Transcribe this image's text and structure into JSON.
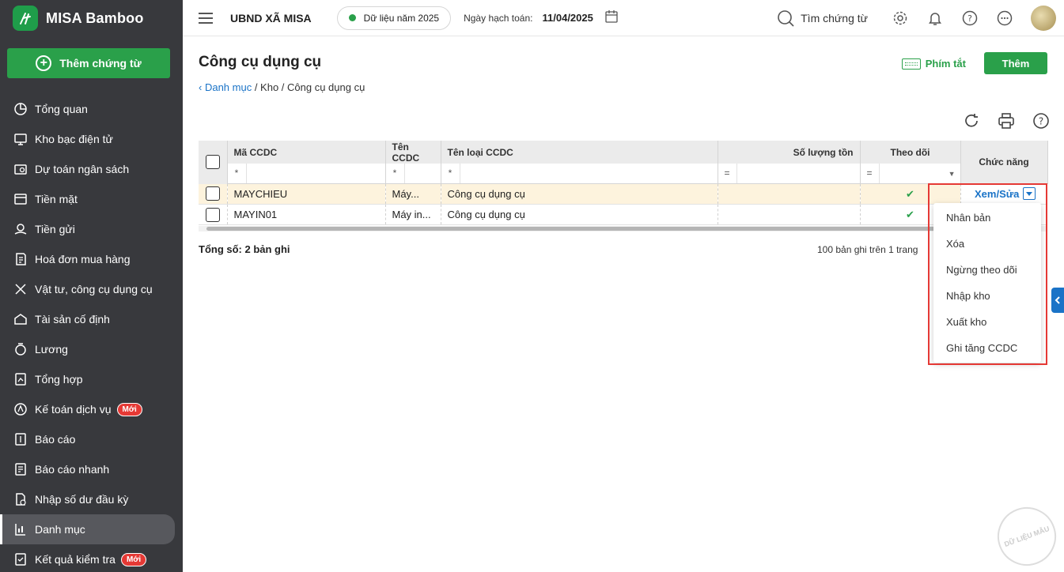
{
  "brand": {
    "name": "MISA Bamboo"
  },
  "sidebar": {
    "add_label": "Thêm chứng từ",
    "items": [
      {
        "label": "Tổng quan",
        "icon": "pie-chart-icon"
      },
      {
        "label": "Kho bạc điện tử",
        "icon": "monitor-icon"
      },
      {
        "label": "Dự toán ngân sách",
        "icon": "budget-icon"
      },
      {
        "label": "Tiền mặt",
        "icon": "cash-icon"
      },
      {
        "label": "Tiền gửi",
        "icon": "deposit-icon"
      },
      {
        "label": "Hoá đơn mua hàng",
        "icon": "invoice-icon"
      },
      {
        "label": "Vật tư, công cụ dụng cụ",
        "icon": "tools-icon"
      },
      {
        "label": "Tài sản cố định",
        "icon": "asset-icon"
      },
      {
        "label": "Lương",
        "icon": "salary-icon"
      },
      {
        "label": "Tổng hợp",
        "icon": "summary-icon"
      },
      {
        "label": "Kế toán dịch vụ",
        "icon": "service-icon",
        "badge": "Mới"
      },
      {
        "label": "Báo cáo",
        "icon": "report-icon"
      },
      {
        "label": "Báo cáo nhanh",
        "icon": "quick-report-icon"
      },
      {
        "label": "Nhập số dư đầu kỳ",
        "icon": "opening-balance-icon"
      },
      {
        "label": "Danh mục",
        "icon": "catalog-icon",
        "active": true
      },
      {
        "label": "Kết quả kiểm tra",
        "icon": "check-result-icon",
        "badge": "Mới"
      }
    ]
  },
  "header": {
    "org": "UBND XÃ MISA",
    "data_year": "Dữ liệu năm 2025",
    "accounting_date_label": "Ngày hạch toán:",
    "accounting_date": "11/04/2025",
    "search_label": "Tìm chứng từ"
  },
  "page": {
    "title": "Công cụ dụng cụ",
    "breadcrumb": {
      "back": "Danh mục",
      "rest": " / Kho / Công cụ dụng cụ"
    },
    "shortcut_label": "Phím tắt",
    "add_label": "Thêm"
  },
  "table": {
    "columns": [
      "Mã CCDC",
      "Tên CCDC",
      "Tên loại CCDC",
      "Số lượng tồn",
      "Theo dõi",
      "Chức năng"
    ],
    "filter_ops": [
      "*",
      "*",
      "*",
      "=",
      "="
    ],
    "rows": [
      {
        "code": "MAYCHIEU",
        "name": "Máy...",
        "type": "Công cụ dụng cụ",
        "qty": "",
        "tracked": true
      },
      {
        "code": "MAYIN01",
        "name": "Máy in...",
        "type": "Công cụ dụng cụ",
        "qty": "",
        "tracked": true
      }
    ],
    "total": "Tổng số: 2 bản ghi",
    "paging": "100 bản ghi trên 1 trang"
  },
  "row_action": {
    "label": "Xem/Sửa",
    "menu": [
      "Nhân bản",
      "Xóa",
      "Ngừng theo dõi",
      "Nhập kho",
      "Xuất kho",
      "Ghi tăng CCDC"
    ]
  },
  "watermark": "DỮ LIỆU MẪU",
  "colors": {
    "accent_green": "#2aa04a",
    "link_blue": "#1a73c7",
    "sidebar_bg": "#38393d",
    "highlight_red": "#e53935"
  }
}
